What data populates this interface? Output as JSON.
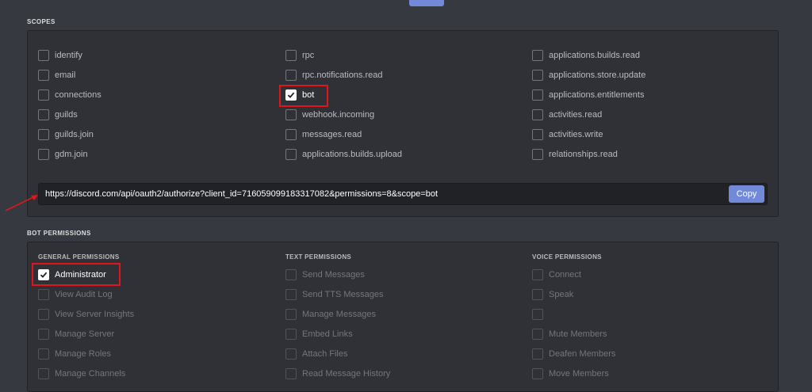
{
  "scopes": {
    "title": "SCOPES",
    "col1": [
      {
        "label": "identify",
        "checked": false
      },
      {
        "label": "email",
        "checked": false
      },
      {
        "label": "connections",
        "checked": false
      },
      {
        "label": "guilds",
        "checked": false
      },
      {
        "label": "guilds.join",
        "checked": false
      },
      {
        "label": "gdm.join",
        "checked": false
      }
    ],
    "col2": [
      {
        "label": "rpc",
        "checked": false
      },
      {
        "label": "rpc.notifications.read",
        "checked": false
      },
      {
        "label": "bot",
        "checked": true
      },
      {
        "label": "webhook.incoming",
        "checked": false
      },
      {
        "label": "messages.read",
        "checked": false
      },
      {
        "label": "applications.builds.upload",
        "checked": false
      }
    ],
    "col3": [
      {
        "label": "applications.builds.read",
        "checked": false
      },
      {
        "label": "applications.store.update",
        "checked": false
      },
      {
        "label": "applications.entitlements",
        "checked": false
      },
      {
        "label": "activities.read",
        "checked": false
      },
      {
        "label": "activities.write",
        "checked": false
      },
      {
        "label": "relationships.read",
        "checked": false
      }
    ],
    "url": "https://discord.com/api/oauth2/authorize?client_id=716059099183317082&permissions=8&scope=bot",
    "copy_label": "Copy"
  },
  "bot_permissions": {
    "title": "BOT PERMISSIONS",
    "general": {
      "heading": "GENERAL PERMISSIONS",
      "items": [
        {
          "label": "Administrator",
          "checked": true,
          "disabled": false
        },
        {
          "label": "View Audit Log",
          "checked": false,
          "disabled": true
        },
        {
          "label": "View Server Insights",
          "checked": false,
          "disabled": true
        },
        {
          "label": "Manage Server",
          "checked": false,
          "disabled": true
        },
        {
          "label": "Manage Roles",
          "checked": false,
          "disabled": true
        },
        {
          "label": "Manage Channels",
          "checked": false,
          "disabled": true
        }
      ]
    },
    "text": {
      "heading": "TEXT PERMISSIONS",
      "items": [
        {
          "label": "Send Messages",
          "checked": false,
          "disabled": true
        },
        {
          "label": "Send TTS Messages",
          "checked": false,
          "disabled": true
        },
        {
          "label": "Manage Messages",
          "checked": false,
          "disabled": true
        },
        {
          "label": "Embed Links",
          "checked": false,
          "disabled": true
        },
        {
          "label": "Attach Files",
          "checked": false,
          "disabled": true
        },
        {
          "label": "Read Message History",
          "checked": false,
          "disabled": true
        }
      ]
    },
    "voice": {
      "heading": "VOICE PERMISSIONS",
      "items": [
        {
          "label": "Connect",
          "checked": false,
          "disabled": true
        },
        {
          "label": "Speak",
          "checked": false,
          "disabled": true
        },
        {
          "label": "",
          "checked": false,
          "disabled": true
        },
        {
          "label": "Mute Members",
          "checked": false,
          "disabled": true
        },
        {
          "label": "Deafen Members",
          "checked": false,
          "disabled": true
        },
        {
          "label": "Move Members",
          "checked": false,
          "disabled": true
        }
      ]
    }
  },
  "colors": {
    "background": "#36393f",
    "panel": "#2f3136",
    "accent": "#7289da",
    "highlight": "#e0161b"
  }
}
